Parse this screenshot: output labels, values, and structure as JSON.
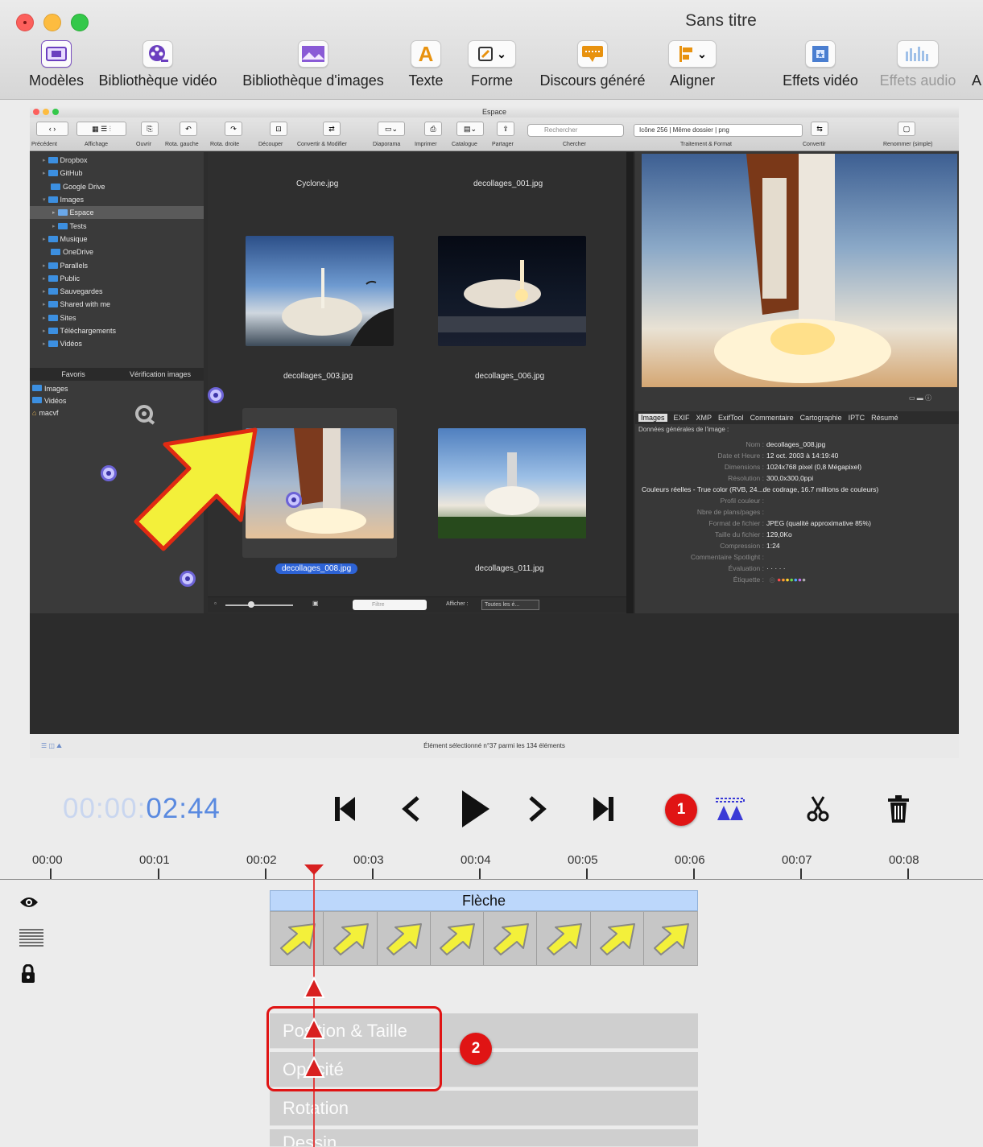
{
  "window": {
    "title": "Sans titre"
  },
  "toolbar": {
    "items": [
      {
        "label": "Modèles",
        "icon": "templates-icon"
      },
      {
        "label": "Bibliothèque vidéo",
        "icon": "video-library-icon"
      },
      {
        "label": "Bibliothèque d'images",
        "icon": "image-library-icon"
      },
      {
        "label": "Texte",
        "icon": "text-icon"
      },
      {
        "label": "Forme",
        "icon": "shape-icon"
      },
      {
        "label": "Discours généré",
        "icon": "speech-icon"
      },
      {
        "label": "Aligner",
        "icon": "align-icon"
      },
      {
        "label": "Effets vidéo",
        "icon": "video-effects-icon"
      },
      {
        "label": "Effets audio",
        "icon": "audio-effects-icon"
      },
      {
        "label": "A",
        "icon": ""
      }
    ]
  },
  "screenshot": {
    "window_title": "Espace",
    "toolbar_labels": [
      "Précédent",
      "Affichage",
      "Ouvrir",
      "Rota. gauche",
      "Rota. droite",
      "Découper",
      "Convertir & Modifier",
      "Diaporama",
      "Imprimer",
      "Catalogue",
      "Partager",
      "Chercher",
      "Traitement & Format",
      "Convertir",
      "Renommer (simple)"
    ],
    "search_placeholder": "Rechercher",
    "format_value": "Icône 256 | Même dossier | png",
    "tree": [
      "Dropbox",
      "GitHub",
      "Google Drive",
      "Images",
      "Espace",
      "Tests",
      "Musique",
      "OneDrive",
      "Parallels",
      "Public",
      "Sauvegardes",
      "Shared with me",
      "Sites",
      "Téléchargements",
      "Vidéos"
    ],
    "tabs": [
      "Favoris",
      "Vérification images"
    ],
    "favorites": [
      "Images",
      "Vidéos",
      "macvf"
    ],
    "thumbs": [
      {
        "label": "Cyclone.jpg"
      },
      {
        "label": "decollages_001.jpg"
      },
      {
        "label": "decollages_003.jpg"
      },
      {
        "label": "decollages_006.jpg"
      },
      {
        "label": "decollages_008.jpg"
      },
      {
        "label": "decollages_011.jpg"
      }
    ],
    "filter_placeholder": "Filtre",
    "show_label": "Afficher :",
    "show_value": "Toutes les é...",
    "info_tabs": [
      "Images",
      "EXIF",
      "XMP",
      "ExifTool",
      "Commentaire",
      "Cartographie",
      "IPTC",
      "Résumé"
    ],
    "info_header": "Données générales de l'image :",
    "info": [
      {
        "k": "Nom :",
        "v": "decollages_008.jpg"
      },
      {
        "k": "Date et Heure :",
        "v": "12 oct. 2003 à 14:19:40"
      },
      {
        "k": "Dimensions :",
        "v": "1024x768 pixel (0,8 Mégapixel)"
      },
      {
        "k": "Résolution :",
        "v": "300,0x300,0ppi"
      },
      {
        "k": "Couleurs réelles - True color (RVB, 24...de codrage, 16.7 millions de couleurs)",
        "v": ""
      },
      {
        "k": "Profil couleur :",
        "v": ""
      },
      {
        "k": "Nbre de plans/pages :",
        "v": ""
      },
      {
        "k": "Format de fichier :",
        "v": "JPEG (qualité approximative 85%)"
      },
      {
        "k": "Taille du fichier :",
        "v": "129,0Ko"
      },
      {
        "k": "Compression :",
        "v": "1:24"
      },
      {
        "k": "Commentaire Spotlight :",
        "v": ""
      },
      {
        "k": "Évaluation :",
        "v": "· · · · ·"
      },
      {
        "k": "Étiquette :",
        "v": ""
      }
    ],
    "status": "Élément sélectionné n°37 parmi les 134 éléments"
  },
  "timeline": {
    "timecode_dim": "00:00:",
    "timecode_active": "02:44",
    "ticks": [
      "00:00",
      "00:01",
      "00:02",
      "00:03",
      "00:04",
      "00:05",
      "00:06",
      "00:07",
      "00:08"
    ],
    "track_name": "Flèche",
    "properties": [
      "Position & Taille",
      "Opacité",
      "Rotation",
      "Dessin"
    ],
    "badge1": "1",
    "badge2": "2"
  },
  "colors": {
    "accent_red": "#e01414",
    "timecode_blue": "#5a8ae0",
    "track_blue": "#bcd7fb"
  }
}
